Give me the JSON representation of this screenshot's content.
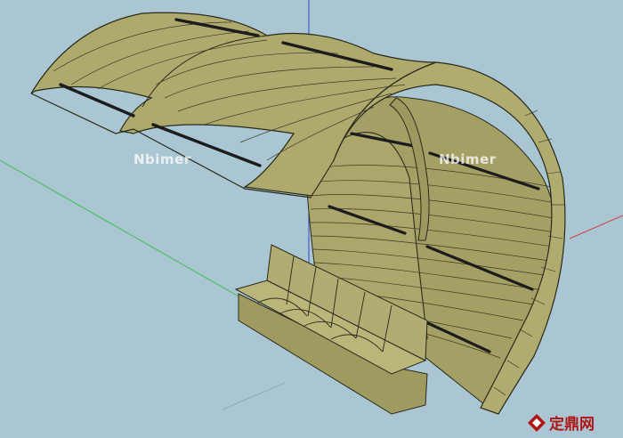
{
  "viewport": {
    "model": "curved-wooden-canopy-with-bench",
    "colors": {
      "background": "#a9c6d2",
      "wood_fill": "#a9a56a",
      "wood_dark": "#8f8b52",
      "wood_light": "#bcb87d",
      "edge": "#2a2a1a",
      "slat_dark": "#1c1c1c",
      "axis_green": "#3cbf55",
      "axis_red": "#d04040",
      "axis_blue": "#3a44c8"
    }
  },
  "watermarks": {
    "left": "Nbimer",
    "right": "Nbimer"
  },
  "logo": {
    "text": "定鼎网",
    "icon": "dingding-logo-icon",
    "color": "#b01515"
  }
}
